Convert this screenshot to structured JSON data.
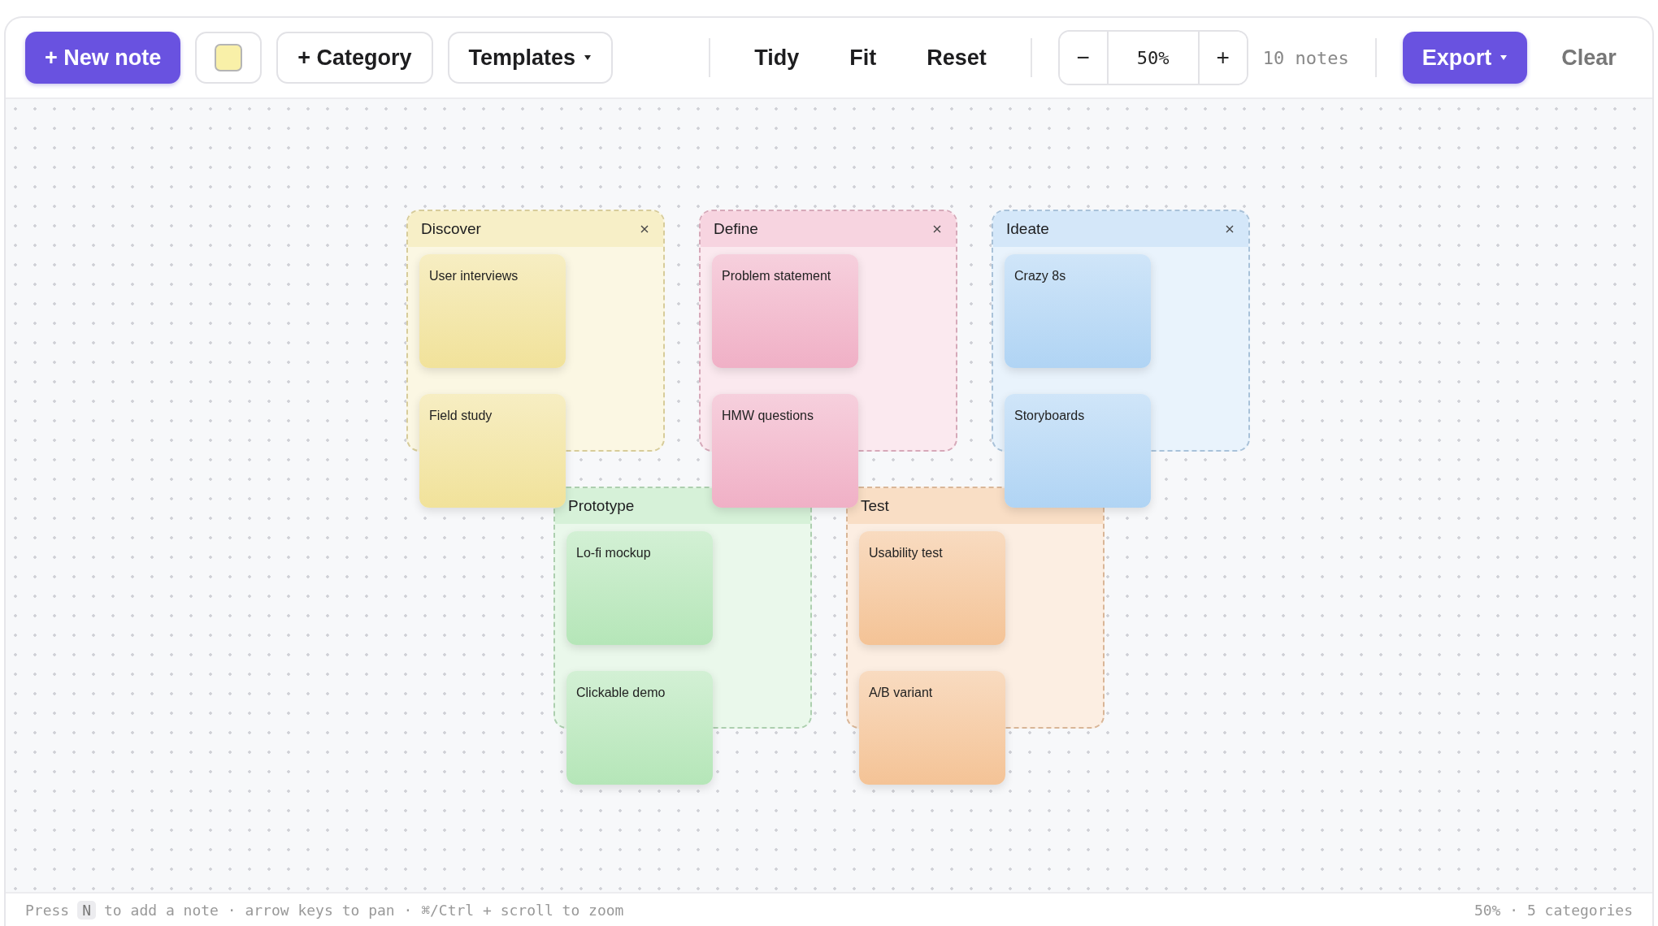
{
  "toolbar": {
    "new_note": "+ New note",
    "swatch": {
      "color": "#f9f0a8"
    },
    "category": "+ Category",
    "templates": "Templates",
    "actions": [
      "Tidy",
      "Fit",
      "Reset"
    ],
    "zoom": {
      "minus": "−",
      "value": "50%",
      "plus": "+"
    },
    "note_count": "10 notes",
    "export": "Export",
    "clear": "Clear"
  },
  "categories": [
    {
      "title": "Discover",
      "color": "#f1e29a",
      "notes": [
        "User interviews",
        "Field study"
      ]
    },
    {
      "title": "Define",
      "color": "#f0b0c6",
      "notes": [
        "Problem statement",
        "HMW questions"
      ]
    },
    {
      "title": "Ideate",
      "color": "#b0d4f4",
      "notes": [
        "Crazy 8s",
        "Storyboards"
      ]
    },
    {
      "title": "Prototype",
      "color": "#b5e6b8",
      "notes": [
        "Lo-fi mockup",
        "Clickable demo"
      ]
    },
    {
      "title": "Test",
      "color": "#f4c396",
      "notes": [
        "Usability test",
        "A/B variant"
      ]
    }
  ],
  "footer": {
    "hint_start": "Press",
    "key": "N",
    "hint_end": "to add a note · arrow keys to pan · ⌘/Ctrl + scroll to zoom",
    "status": "50% · 5 categories"
  }
}
